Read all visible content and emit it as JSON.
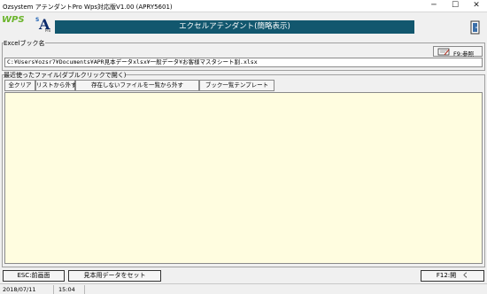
{
  "window": {
    "title": "Ozsystem アテンダントPro Wps対応版V1.00 (APRY5601)",
    "minimize_glyph": "─",
    "maximize_glyph": "☐",
    "close_glyph": "✕"
  },
  "logos": {
    "wps": "WPS",
    "a_small": "S",
    "a_big": "A",
    "a_sub": "Pro"
  },
  "banner": {
    "text": "エクセルアテンダント(簡略表示)"
  },
  "excel_book": {
    "label": "Excelブック名",
    "ref_button": "F9:参照",
    "path": "C:¥Users¥ozsr7¥Documents¥APR見本データxlsx¥一般データ¥お客様マスタシート割.xlsx"
  },
  "recent": {
    "label": "最近使ったファイル(ダブルクリックで開く)",
    "buttons": [
      "全クリア",
      "リストから外す",
      "存在しないファイルを一覧から外す",
      "ブック一覧テンプレート"
    ]
  },
  "bottom": {
    "esc_button": "ESC:前画面",
    "sample_button": "見本用データをセット",
    "f12_button": "F12:開　く"
  },
  "status": {
    "date": "2018/07/11",
    "time": "15:04"
  },
  "colors": {
    "banner": "#12576e",
    "list_bg": "#fffde0",
    "wps_green": "#6ab42a"
  }
}
